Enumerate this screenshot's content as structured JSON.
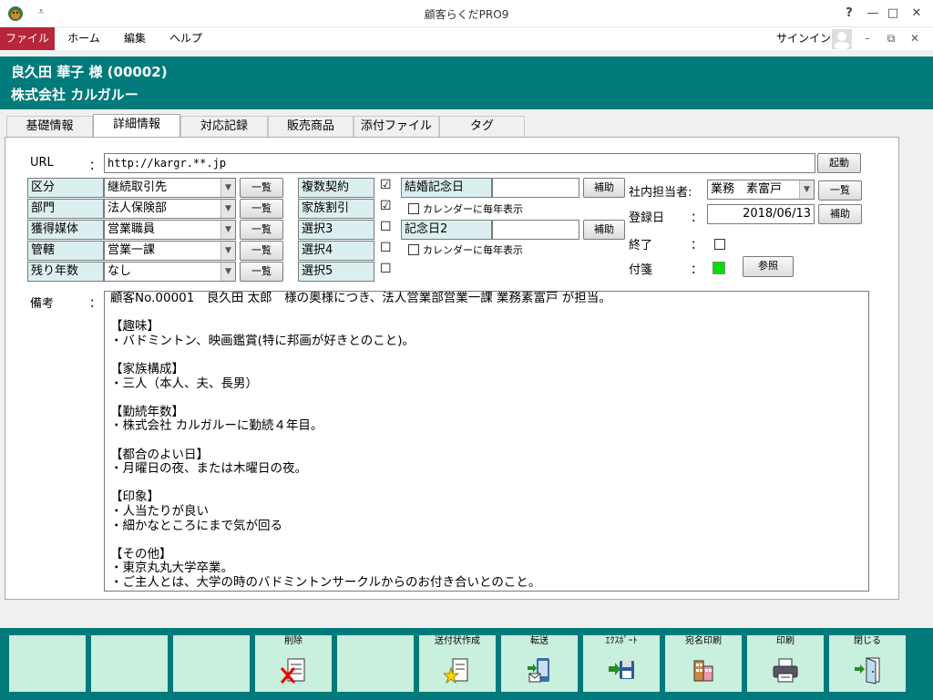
{
  "window": {
    "title": "顧客らくだPRO9",
    "help_glyph": "?",
    "minimize_glyph": "—",
    "maximize_glyph": "□",
    "close_glyph": "✕",
    "qat_glyph": "⩡"
  },
  "menubar": {
    "items": [
      "ファイル",
      "ホーム",
      "編集",
      "ヘルプ"
    ],
    "signin": "サインイン",
    "ribbon_min_glyph": "–",
    "ribbon_restore_glyph": "⧉"
  },
  "header": {
    "customer_name": "良久田 華子 様 (00002)",
    "company": "株式会社 カルガルー"
  },
  "tabs": [
    "基礎情報",
    "詳細情報",
    "対応記録",
    "販売商品",
    "添付ファイル",
    "タグ"
  ],
  "form": {
    "url_label": "URL",
    "colon": "：",
    "url_value": "http://kargr.**.jp",
    "launch_button": "起動",
    "rows": [
      {
        "label": "区分",
        "value": "継続取引先",
        "button": "一覧"
      },
      {
        "label": "部門",
        "value": "法人保険部",
        "button": "一覧"
      },
      {
        "label": "獲得媒体",
        "value": "営業職員",
        "button": "一覧"
      },
      {
        "label": "管轄",
        "value": "営業一課",
        "button": "一覧"
      },
      {
        "label": "残り年数",
        "value": "なし",
        "button": "一覧"
      }
    ],
    "flags": [
      {
        "label": "複数契約",
        "checked": "☑"
      },
      {
        "label": "家族割引",
        "checked": "☑"
      },
      {
        "label": "選択3",
        "checked": "☐"
      },
      {
        "label": "選択4",
        "checked": "☐"
      },
      {
        "label": "選択5",
        "checked": "☐"
      }
    ],
    "dates": [
      {
        "label": "結婚記念日",
        "value": "",
        "button": "補助",
        "calendar": "カレンダーに毎年表示"
      },
      {
        "label": "記念日2",
        "value": "",
        "button": "補助",
        "calendar": "カレンダーに毎年表示"
      }
    ],
    "staff_label": "社内担当者:",
    "staff_value": "業務　素富戸",
    "staff_button": "一覧",
    "reg_label": "登録日",
    "reg_value": "2018/06/13",
    "reg_button": "補助",
    "end_label": "終了",
    "tag_label": "付箋",
    "tag_color": "#00e000",
    "ref_button": "参照",
    "memo_label": "備考",
    "memo_text": "顧客No.00001　良久田 太郎　様の奥様につき、法人営業部営業一課 業務素富戸 が担当。\n\n【趣味】\n・バドミントン、映画鑑賞(特に邦画が好きとのこと)。\n\n【家族構成】\n・三人（本人、夫、長男）\n\n【勤続年数】\n・株式会社 カルガルーに勤続４年目。\n\n【都合のよい日】\n・月曜日の夜、または木曜日の夜。\n\n【印象】\n・人当たりが良い\n・細かなところにまで気が回る\n\n【その他】\n・東京丸丸大学卒業。\n・ご主人とは、大学の時のバドミントンサークルからのお付き合いとのこと。"
  },
  "footer": {
    "buttons": [
      {
        "label": "",
        "icon": ""
      },
      {
        "label": "",
        "icon": ""
      },
      {
        "label": "",
        "icon": ""
      },
      {
        "label": "削除",
        "icon": "delete-icon"
      },
      {
        "label": "",
        "icon": ""
      },
      {
        "label": "送付状作成",
        "icon": "cover-letter-icon"
      },
      {
        "label": "転送",
        "icon": "forward-icon"
      },
      {
        "label": "ｴｸｽﾎﾟｰﾄ",
        "icon": "export-icon"
      },
      {
        "label": "宛名印刷",
        "icon": "address-print-icon"
      },
      {
        "label": "印刷",
        "icon": "print-icon"
      },
      {
        "label": "閉じる",
        "icon": "close-door-icon"
      }
    ]
  }
}
